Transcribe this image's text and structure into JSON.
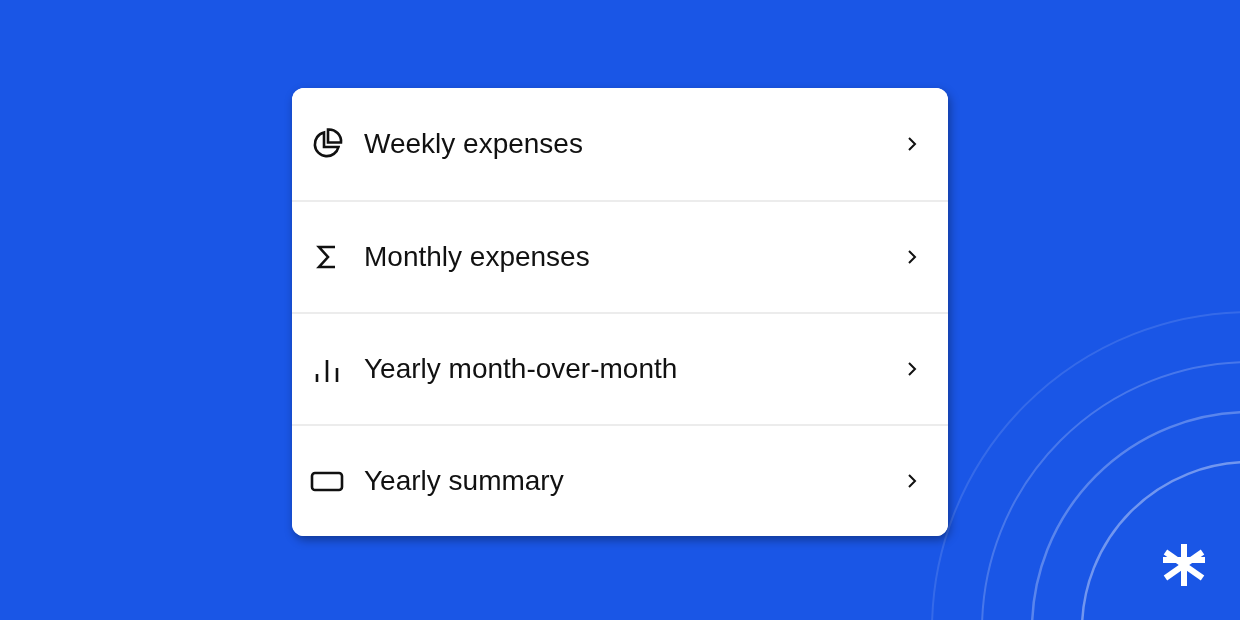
{
  "menu": {
    "items": [
      {
        "kind": "pie",
        "label": "Weekly expenses"
      },
      {
        "kind": "sigma",
        "label": "Monthly expenses"
      },
      {
        "kind": "bars",
        "label": "Yearly month-over-month"
      },
      {
        "kind": "card",
        "label": "Yearly summary"
      }
    ]
  }
}
